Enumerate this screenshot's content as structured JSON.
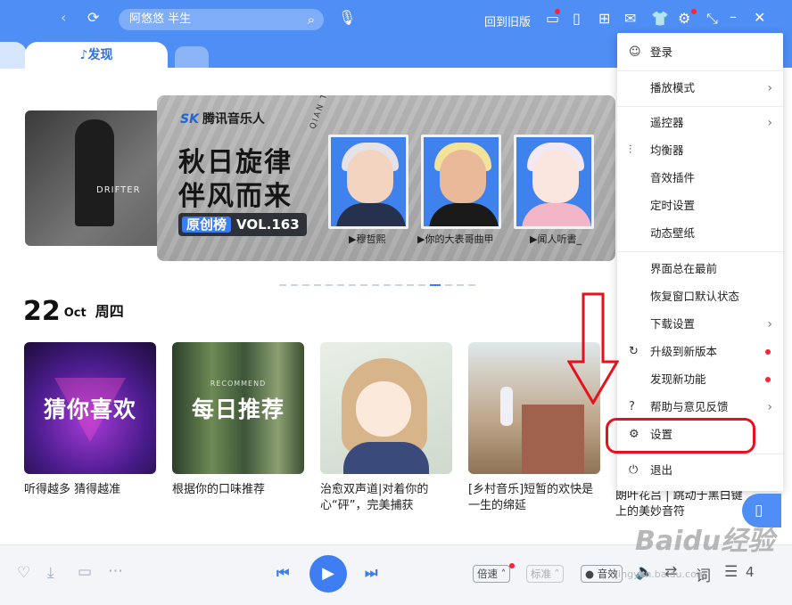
{
  "topbar": {
    "search_value": "阿悠悠 半生",
    "back_old_label": "回到旧版",
    "tabs": [
      "发现"
    ]
  },
  "banner": {
    "brand": "腾讯音乐人",
    "brand_mark": "SK",
    "side_text": "QIAN TENCEN",
    "headline1": "秋日旋律",
    "headline2": "伴风而来",
    "tag_pill": "原创榜",
    "tag_vol": "VOL.163",
    "left_text": "DRIFTER",
    "artists": [
      "▶穆哲熙",
      "▶你的大表哥曲甲",
      "▶闻人听書_"
    ]
  },
  "date": {
    "day": "22",
    "month": "Oct",
    "weekday": "周四"
  },
  "cards": [
    {
      "title": "听得越多 猜得越准",
      "overlay": "猜你喜欢"
    },
    {
      "title": "根据你的口味推荐",
      "overlay": "每日推荐",
      "overlay_sub": "RECOMMEND"
    },
    {
      "title": "治愈双声道|对着你的心“砰”，完美捕获"
    },
    {
      "title": "[乡村音乐]短暂的欢快是一生的绵延"
    }
  ],
  "card5_text": "朗叶花吕 | 跳动于黑白键上的美妙音符",
  "menu": {
    "items": [
      {
        "label": "登录",
        "icon": "user-icon"
      },
      {
        "label": "播放模式",
        "arrow": true
      },
      {
        "label": "遥控器",
        "arrow": true
      },
      {
        "label": "均衡器",
        "icon": "equalizer-icon"
      },
      {
        "label": "音效插件"
      },
      {
        "label": "定时设置"
      },
      {
        "label": "动态壁纸"
      },
      {
        "label": "界面总在最前"
      },
      {
        "label": "恢复窗口默认状态"
      },
      {
        "label": "下载设置",
        "arrow": true
      },
      {
        "label": "升级到新版本",
        "icon": "upgrade-icon",
        "dot": true
      },
      {
        "label": "发现新功能",
        "dot": true
      },
      {
        "label": "帮助与意见反馈",
        "icon": "help-icon",
        "arrow": true
      },
      {
        "label": "设置",
        "icon": "gear-icon"
      },
      {
        "label": "退出",
        "icon": "power-icon"
      }
    ]
  },
  "player": {
    "speed_label": "倍速",
    "quality_label": "标准",
    "effect_label": "音效",
    "lyrics_label": "词",
    "count": "4"
  },
  "watermark": "Baidu经验",
  "watermark_sub": "jingyan.baidu.com",
  "colors": {
    "brand_blue": "#4f8ef5",
    "accent": "#3f7ef2",
    "alert_red": "#e8101a"
  }
}
